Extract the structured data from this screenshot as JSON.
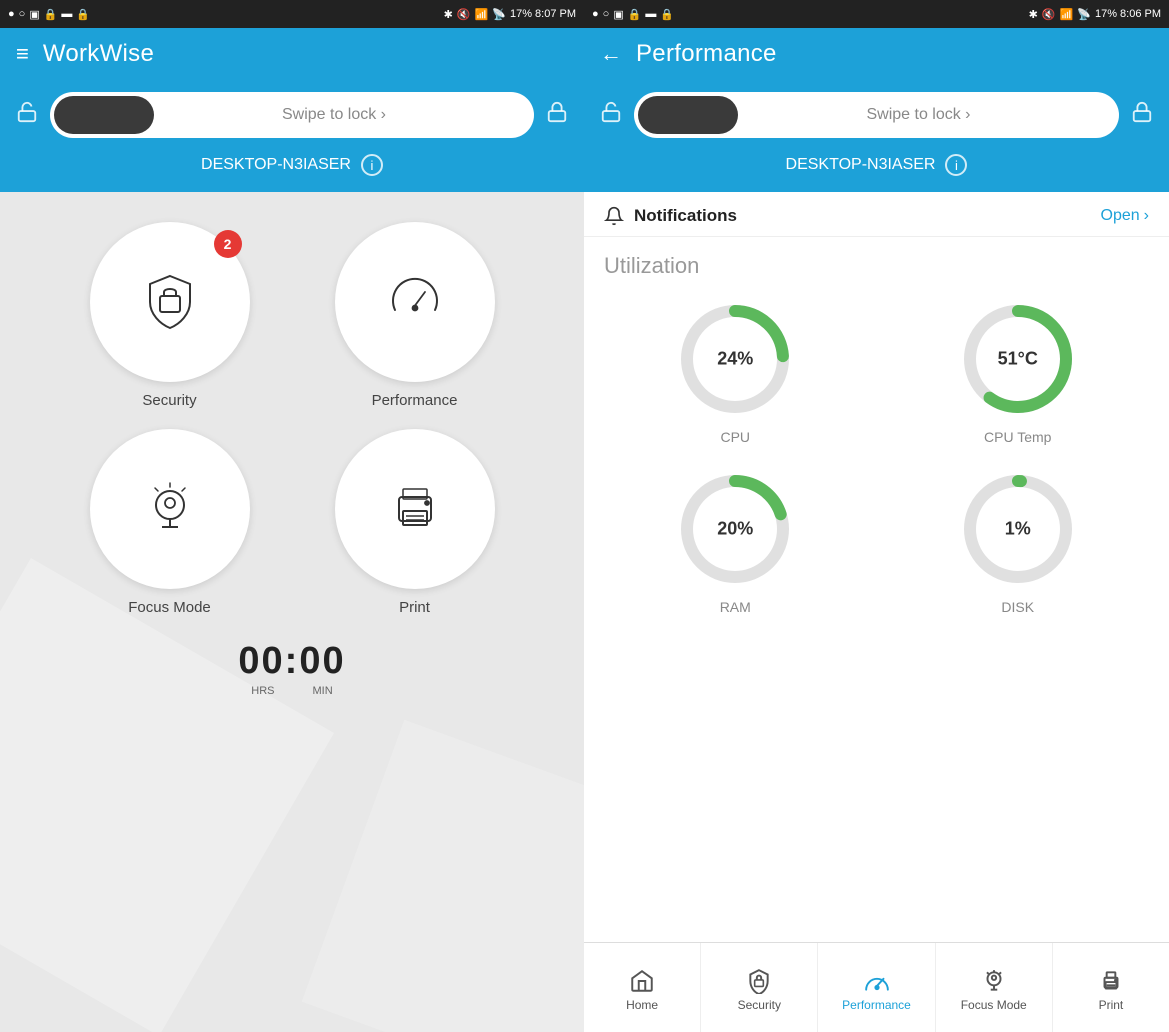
{
  "left_panel": {
    "status_bar": {
      "left_icons": "● ○ ▣ 🔒 ▬ 🔒",
      "right_info": "17%  8:07 PM"
    },
    "header": {
      "menu_icon": "≡",
      "title": "WorkWise"
    },
    "swipe": {
      "text": "Swipe to lock  ›",
      "device_name": "DESKTOP-N3IASER"
    },
    "icons": [
      {
        "id": "security",
        "label": "Security",
        "badge": "2"
      },
      {
        "id": "performance",
        "label": "Performance",
        "badge": null
      },
      {
        "id": "focus_mode",
        "label": "Focus Mode",
        "badge": null
      },
      {
        "id": "print",
        "label": "Print",
        "badge": null
      }
    ],
    "timer": {
      "value": "00:00",
      "hrs_label": "HRS",
      "min_label": "MIN"
    }
  },
  "right_panel": {
    "status_bar": {
      "right_info": "17%  8:06 PM"
    },
    "header": {
      "back_icon": "←",
      "title": "Performance"
    },
    "swipe": {
      "text": "Swipe to lock  ›",
      "device_name": "DESKTOP-N3IASER"
    },
    "notifications": {
      "title": "Notifications",
      "open_label": "Open",
      "chevron": "›"
    },
    "utilization": {
      "title": "Utilization",
      "items": [
        {
          "id": "cpu",
          "label": "CPU",
          "value": "24%",
          "percent": 24
        },
        {
          "id": "cpu_temp",
          "label": "CPU Temp",
          "value": "51°C",
          "percent": 60
        },
        {
          "id": "ram",
          "label": "RAM",
          "value": "20%",
          "percent": 20
        },
        {
          "id": "disk",
          "label": "DISK",
          "value": "1%",
          "percent": 1
        }
      ]
    },
    "bottom_nav": [
      {
        "id": "home",
        "label": "Home",
        "active": false
      },
      {
        "id": "security",
        "label": "Security",
        "active": false
      },
      {
        "id": "performance",
        "label": "Performance",
        "active": true
      },
      {
        "id": "focus_mode",
        "label": "Focus Mode",
        "active": false
      },
      {
        "id": "print",
        "label": "Print",
        "active": false
      }
    ]
  }
}
